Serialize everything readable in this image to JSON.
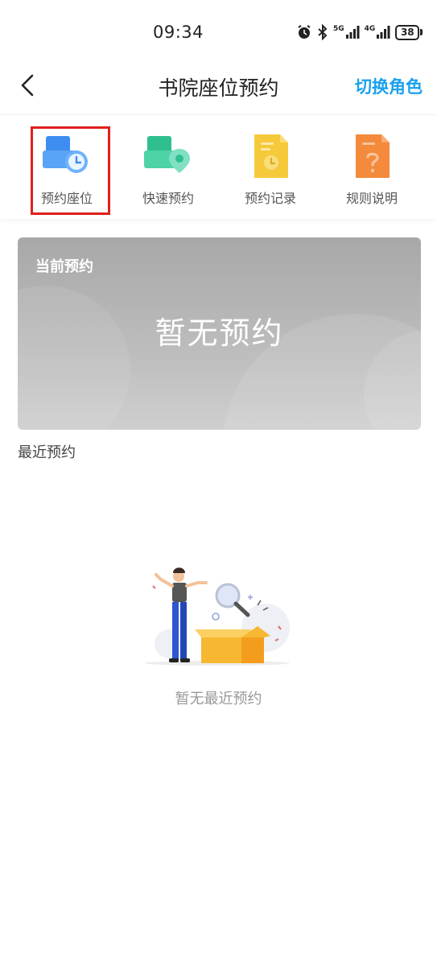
{
  "status_bar": {
    "time": "09:34",
    "signal_5g_label": "5G",
    "signal_4g_label": "4G",
    "battery_level": "38"
  },
  "header": {
    "title": "书院座位预约",
    "switch_role_label": "切换角色"
  },
  "menu": {
    "items": [
      {
        "label": "预约座位",
        "icon": "seat-clock-icon",
        "color": "#3d8ef0"
      },
      {
        "label": "快速预约",
        "icon": "seat-location-icon",
        "color": "#3ecb9c"
      },
      {
        "label": "预约记录",
        "icon": "record-document-icon",
        "color": "#f6c93a"
      },
      {
        "label": "规则说明",
        "icon": "rules-question-icon",
        "color": "#f48a3c"
      }
    ],
    "highlighted_index": 0,
    "highlight_color": "#e0201c"
  },
  "current_reservation": {
    "title": "当前预约",
    "empty_text": "暂无预约"
  },
  "recent": {
    "section_title": "最近预约",
    "empty_text": "暂无最近预约"
  },
  "colors": {
    "accent": "#1aa0ee",
    "card_gray": "#b3b3b3"
  }
}
